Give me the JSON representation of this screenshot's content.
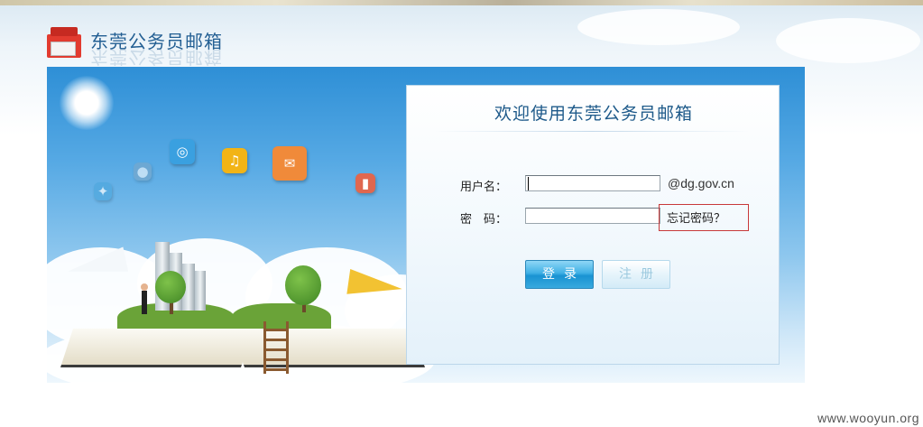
{
  "header": {
    "title": "东莞公务员邮箱"
  },
  "login": {
    "heading": "欢迎使用东莞公务员邮箱",
    "username_label": "用户名：",
    "username_value": "",
    "domain_suffix": "@dg.gov.cn",
    "password_label": "密　码：",
    "password_value": "",
    "forgot_password": "忘记密码？",
    "login_button": "登录",
    "register_button": "注册"
  },
  "watermark": "www.wooyun.org",
  "colors": {
    "brand_blue": "#235f93",
    "login_button": "#1993d2",
    "highlight": "#c8393a"
  }
}
